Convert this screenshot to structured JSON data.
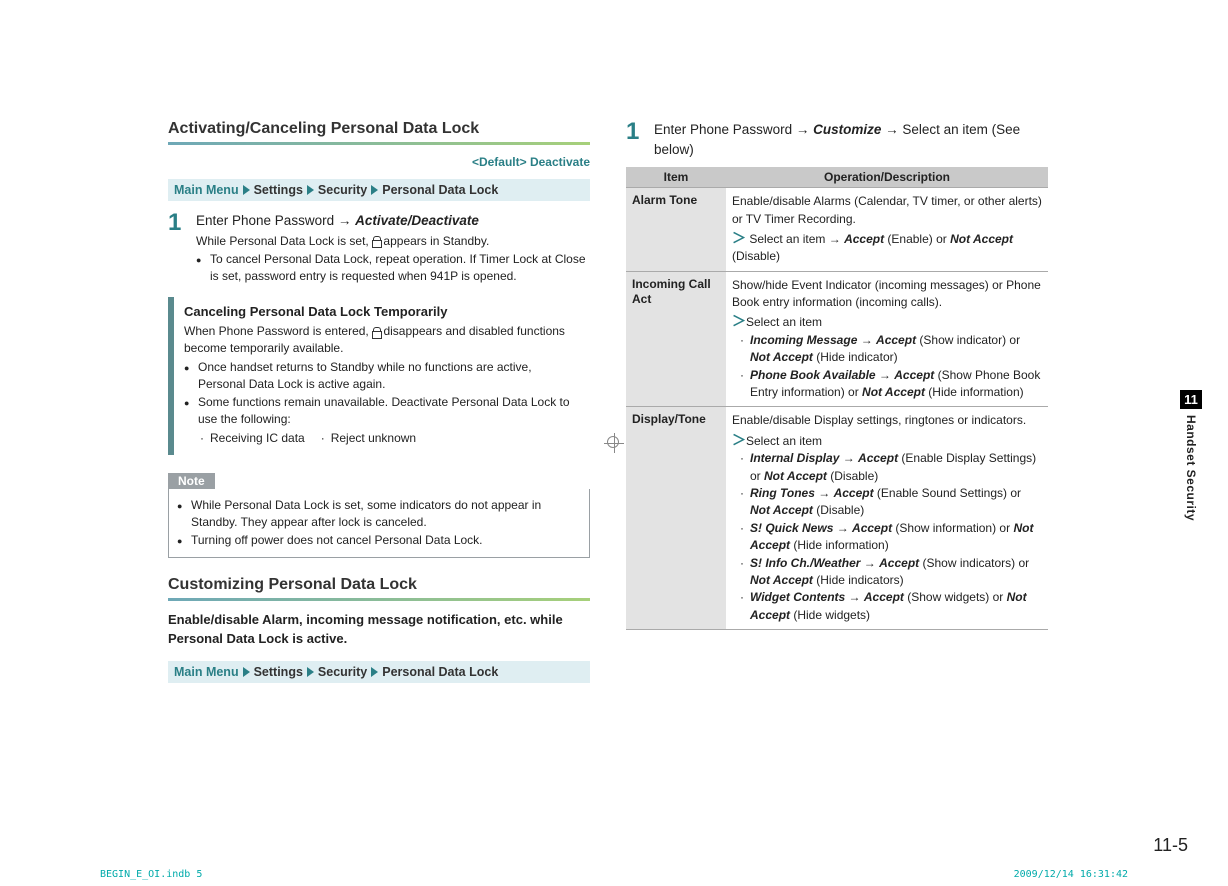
{
  "left": {
    "h_activating": "Activating/Canceling Personal Data Lock",
    "default_line": "<Default> Deactivate",
    "breadcrumb": {
      "main": "Main Menu",
      "b1": "Settings",
      "b2": "Security",
      "b3": "Personal Data Lock"
    },
    "step1": {
      "lead": "Enter Phone Password → ",
      "action": "Activate/Deactivate",
      "while_a": "While Personal Data Lock is set, ",
      "while_b": " appears in Standby.",
      "bullet": "To cancel Personal Data Lock, repeat operation. If Timer Lock at Close is set, password entry is requested when 941P is opened."
    },
    "cancel": {
      "title": "Canceling Personal Data Lock Temporarily",
      "body_a": "When Phone Password is entered, ",
      "body_b": " disappears and disabled functions become temporarily available.",
      "b1": "Once handset returns to Standby while no functions are active, Personal Data Lock is active again.",
      "b2": "Some functions remain unavailable. Deactivate Personal Data Lock to use the following:",
      "d1": "Receiving IC data",
      "d2": "Reject unknown"
    },
    "note": {
      "label": "Note",
      "n1": "While Personal Data Lock is set, some indicators do not appear in Standby. They appear after lock is canceled.",
      "n2": "Turning off power does not cancel Personal Data Lock."
    },
    "h_custom": "Customizing Personal Data Lock",
    "enable_text": "Enable/disable Alarm, incoming message notification, etc. while Personal Data Lock is active."
  },
  "right": {
    "step1": {
      "a": "Enter Phone Password → ",
      "customize": "Customize",
      "b": " → Select an item (See below)"
    },
    "table": {
      "h_item": "Item",
      "h_desc": "Operation/Description",
      "rows": {
        "alarm": {
          "name": "Alarm Tone",
          "d1": "Enable/disable Alarms (Calendar, TV timer, or other alerts) or TV Timer Recording.",
          "sel": "Select an item → ",
          "accept": "Accept",
          "en": " (Enable) or ",
          "notaccept": "Not Accept",
          "dis": " (Disable)"
        },
        "incoming": {
          "name": "Incoming Call Act",
          "d1": "Show/hide Event Indicator (incoming messages) or Phone Book entry information (incoming calls).",
          "sel": "Select an item",
          "l1a": "Incoming Message",
          "l1m": " → ",
          "l1b": "Accept",
          "l1c": " (Show indicator) or ",
          "l1d": "Not Accept",
          "l1e": " (Hide indicator)",
          "l2a": "Phone Book Available",
          "l2m": " → ",
          "l2b": "Accept",
          "l2c": " (Show Phone Book Entry information) or ",
          "l2d": "Not Accept",
          "l2e": " (Hide information)"
        },
        "display": {
          "name": "Display/Tone",
          "d1": "Enable/disable Display settings, ringtones or indicators.",
          "sel": "Select an item",
          "r1a": "Internal Display",
          "r1m": " → ",
          "r1b": "Accept",
          "r1c": " (Enable Display Settings) or ",
          "r1d": "Not Accept",
          "r1e": " (Disable)",
          "r2a": "Ring Tones",
          "r2m": " → ",
          "r2b": "Accept",
          "r2c": " (Enable Sound Settings) or ",
          "r2d": "Not Accept",
          "r2e": " (Disable)",
          "r3a": "S! Quick News",
          "r3m": " → ",
          "r3b": "Accept",
          "r3c": " (Show information) or ",
          "r3d": "Not Accept",
          "r3e": " (Hide information)",
          "r4a": "S! Info Ch./Weather",
          "r4m": " → ",
          "r4b": "Accept",
          "r4c": " (Show indicators) or ",
          "r4d": "Not Accept",
          "r4e": " (Hide indicators)",
          "r5a": "Widget Contents",
          "r5m": " → ",
          "r5b": "Accept",
          "r5c": " (Show widgets) or ",
          "r5d": "Not Accept",
          "r5e": " (Hide widgets)"
        }
      }
    }
  },
  "side": {
    "chapter": "11",
    "title": "Handset Security"
  },
  "page_num": "11-5",
  "imprint": {
    "file": "BEGIN_E_OI.indb   5",
    "ts": "2009/12/14   16:31:42"
  }
}
